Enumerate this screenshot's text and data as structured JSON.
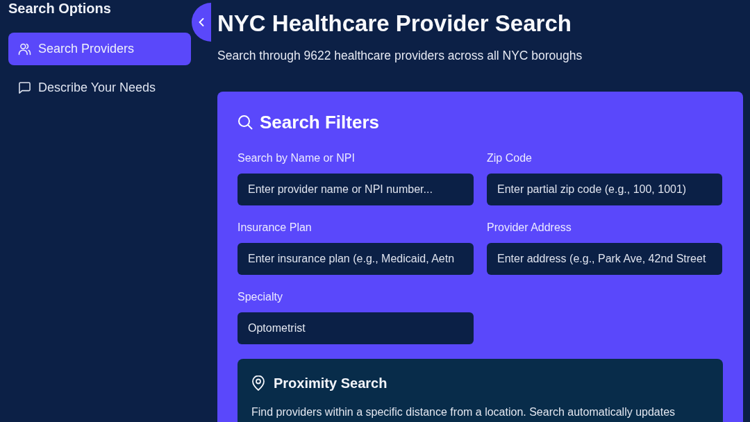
{
  "sidebar": {
    "title": "Search Options",
    "items": [
      {
        "label": "Search Providers",
        "kind": "users",
        "selected": true
      },
      {
        "label": "Describe Your Needs",
        "kind": "chat",
        "selected": false
      }
    ]
  },
  "header": {
    "title": "NYC Healthcare Provider Search",
    "subtitle": "Search through 9622 healthcare providers across all NYC boroughs"
  },
  "filters": {
    "title": "Search Filters",
    "fields": [
      {
        "label": "Search by Name or NPI",
        "placeholder": "Enter provider name or NPI number..."
      },
      {
        "label": "Zip Code",
        "placeholder": "Enter partial zip code (e.g., 100, 1001)"
      },
      {
        "label": "Insurance Plan",
        "placeholder": "Enter insurance plan (e.g., Medicaid, Aetn"
      },
      {
        "label": "Provider Address",
        "placeholder": "Enter address (e.g., Park Ave, 42nd Street"
      },
      {
        "label": "Specialty",
        "value": "Optometrist"
      }
    ]
  },
  "proximity": {
    "title": "Proximity Search",
    "description": "Find providers within a specific distance from a location. Search automatically updates"
  }
}
